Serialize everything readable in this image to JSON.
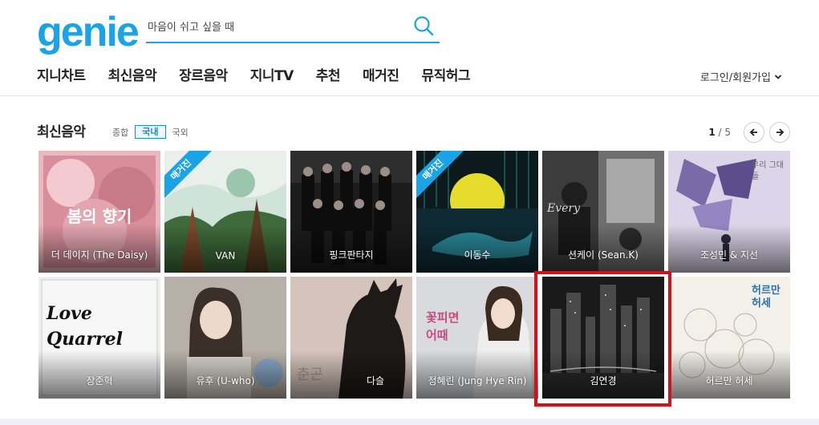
{
  "logo": "genie",
  "search": {
    "placeholder": "마음이 쉬고 싶을 때"
  },
  "nav": [
    "지니차트",
    "최신음악",
    "장르음악",
    "지니TV",
    "추천",
    "매거진",
    "뮤직허그"
  ],
  "login": "로그인/회원가입",
  "section": {
    "title": "최신음악",
    "filters": [
      "종합",
      "국내",
      "국외"
    ],
    "active_filter": "국내",
    "page_current": "1",
    "page_sep": " / ",
    "page_total": "5"
  },
  "albums": [
    {
      "artist": "더 데이지 (The Daisy)",
      "cover_text": "봄의 향기",
      "ribbon": ""
    },
    {
      "artist": "VAN",
      "cover_text": "",
      "ribbon": "매거진"
    },
    {
      "artist": "핑크판타지",
      "cover_text": "",
      "ribbon": ""
    },
    {
      "artist": "이동수",
      "cover_text": "",
      "ribbon": "매거진"
    },
    {
      "artist": "션케이 (Sean.K)",
      "cover_text": "Every",
      "ribbon": ""
    },
    {
      "artist": "조성민 & 지선",
      "cover_text": "우리 그대들",
      "ribbon": ""
    },
    {
      "artist": "장준혁",
      "cover_text": "Love Quarrel",
      "ribbon": ""
    },
    {
      "artist": "유후 (U-who)",
      "cover_text": "",
      "ribbon": ""
    },
    {
      "artist": "다슬",
      "cover_text": "춘곤",
      "ribbon": ""
    },
    {
      "artist": "정혜린 (Jung Hye Rin)",
      "cover_text": "꽃피면 어때",
      "ribbon": ""
    },
    {
      "artist": "김연경",
      "cover_text": "",
      "ribbon": ""
    },
    {
      "artist": "허르만 허세",
      "cover_text": "허르만 허세",
      "ribbon": ""
    }
  ],
  "colors": {
    "brand": "#1aa3e8",
    "highlight": "#d0131a"
  }
}
